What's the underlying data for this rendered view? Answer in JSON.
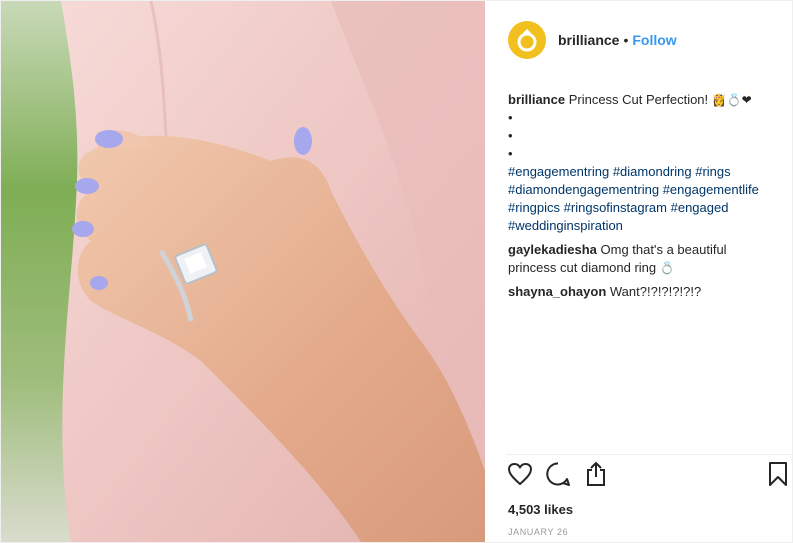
{
  "header": {
    "username": "brilliance",
    "separator": "•",
    "follow_label": "Follow"
  },
  "caption": {
    "username": "brilliance",
    "text": "Princess Cut Perfection!",
    "emojis": "👸💍❤",
    "bullets": [
      "•",
      "•",
      "•"
    ],
    "hashtags": [
      "#engagementring",
      "#diamondring",
      "#rings",
      "#diamondengagementring",
      "#engagementlife",
      "#ringpics",
      "#ringsofinstagram",
      "#engaged",
      "#weddinginspiration"
    ]
  },
  "comments": [
    {
      "username": "gaylekadiesha",
      "text": "Omg that's a beautiful princess cut diamond ring",
      "emoji": "💍"
    },
    {
      "username": "shayna_ohayon",
      "text": "Want?!?!?!?!?!?"
    }
  ],
  "stats": {
    "likes": "4,503 likes",
    "date": "JANUARY 26"
  },
  "icons": {
    "like": "heart-icon",
    "comment": "comment-icon",
    "share": "share-icon",
    "save": "bookmark-icon",
    "avatar": "ring-logo-icon"
  },
  "colors": {
    "brand_avatar": "#f2c01e",
    "follow": "#3897f0",
    "hashtag": "#003569",
    "date": "#999999"
  }
}
